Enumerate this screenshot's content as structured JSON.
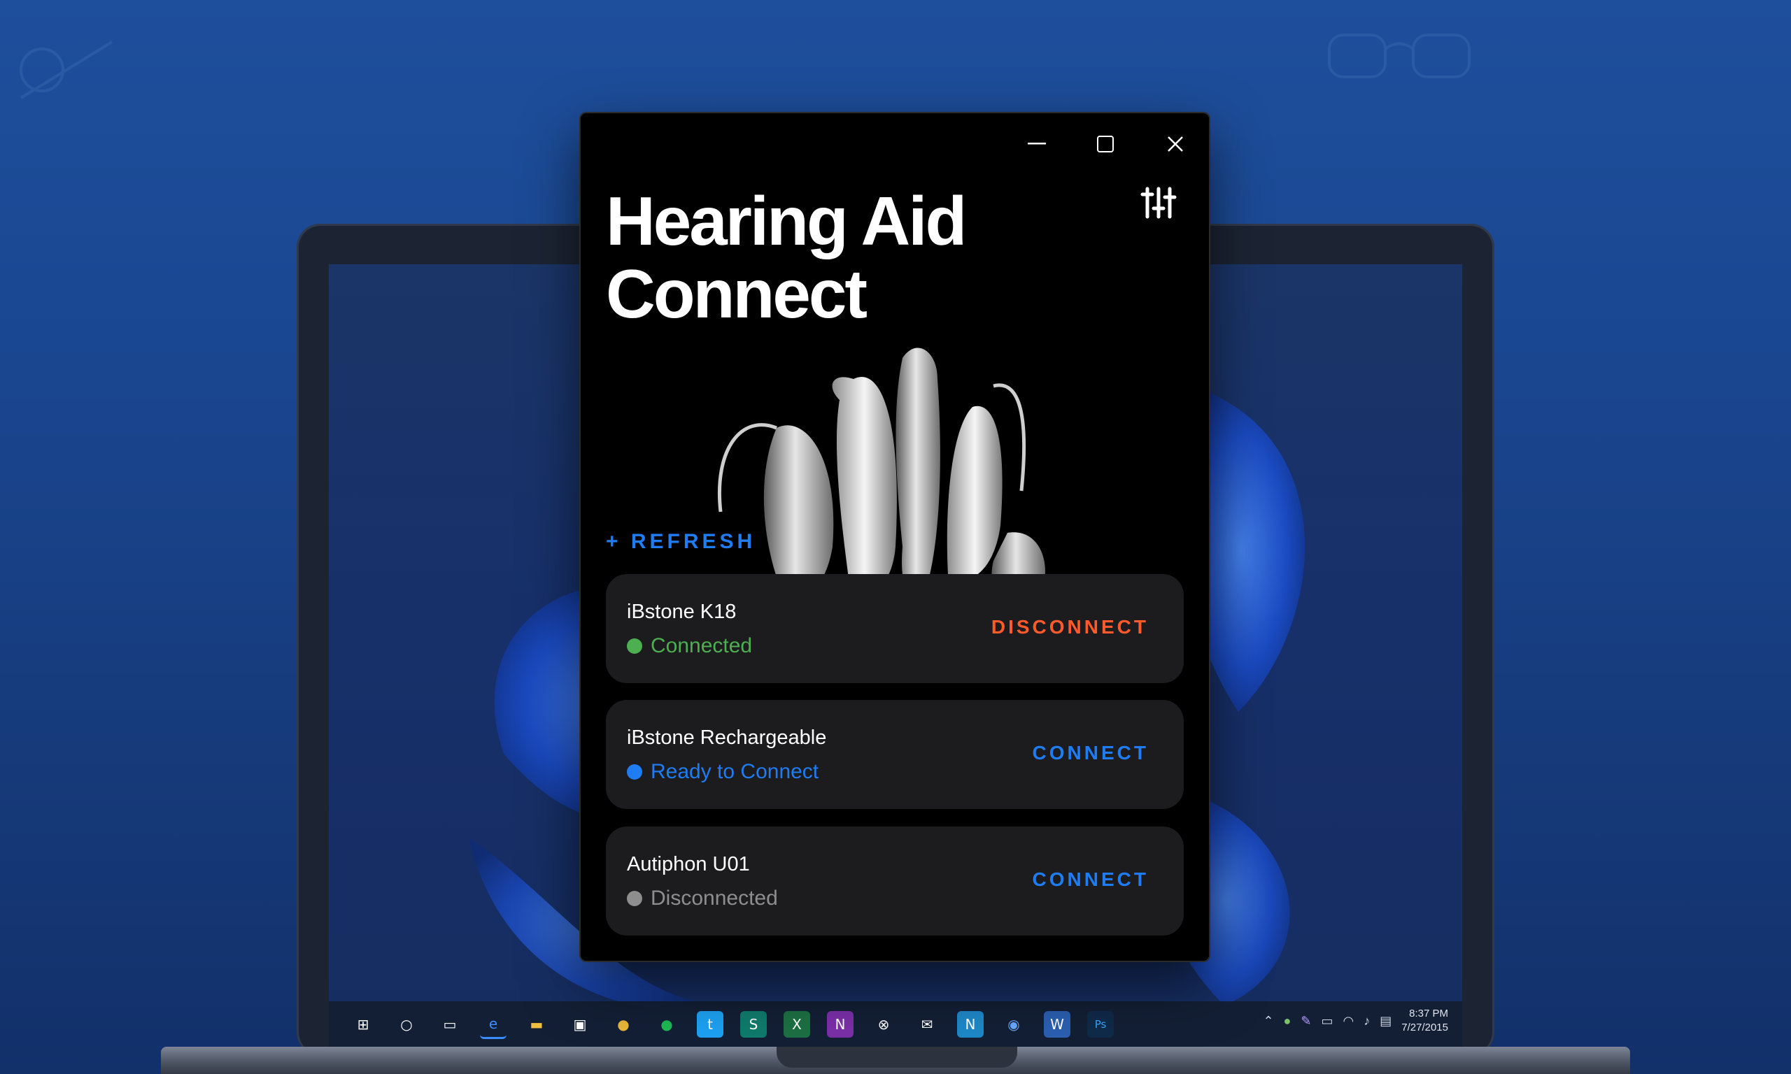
{
  "app": {
    "title_line1": "Hearing Aid",
    "title_line2": "Connect",
    "refresh_label": "+ REFRESH"
  },
  "colors": {
    "accent_blue": "#1f7cf2",
    "connected_green": "#4caf50",
    "disconnect_orange": "#ff5a2b",
    "disconnected_gray": "#8e8e8e",
    "card_bg": "#1c1c1e"
  },
  "devices": [
    {
      "name": "iBstone K18",
      "status": "Connected",
      "status_color": "#4caf50",
      "action": "DISCONNECT",
      "action_color": "#ff5a2b"
    },
    {
      "name": "iBstone Rechargeable",
      "status": "Ready to Connect",
      "status_color": "#1f7cf2",
      "action": "CONNECT",
      "action_color": "#1f7cf2"
    },
    {
      "name": "Autiphon U01",
      "status": "Disconnected",
      "status_color": "#8e8e8e",
      "action": "CONNECT",
      "action_color": "#1f7cf2"
    }
  ],
  "taskbar": {
    "clock_time": "8:37 PM",
    "clock_date": "7/27/2015",
    "icons": [
      "windows-start-icon",
      "search-circle-icon",
      "task-view-icon",
      "edge-icon",
      "file-explorer-icon",
      "store-icon",
      "chrome-icon",
      "spotify-icon",
      "twitter-icon",
      "sway-icon",
      "excel-icon",
      "onenote-icon",
      "xbox-icon",
      "mail-icon",
      "n-app-icon",
      "remote-icon",
      "word-icon",
      "photoshop-icon"
    ]
  }
}
